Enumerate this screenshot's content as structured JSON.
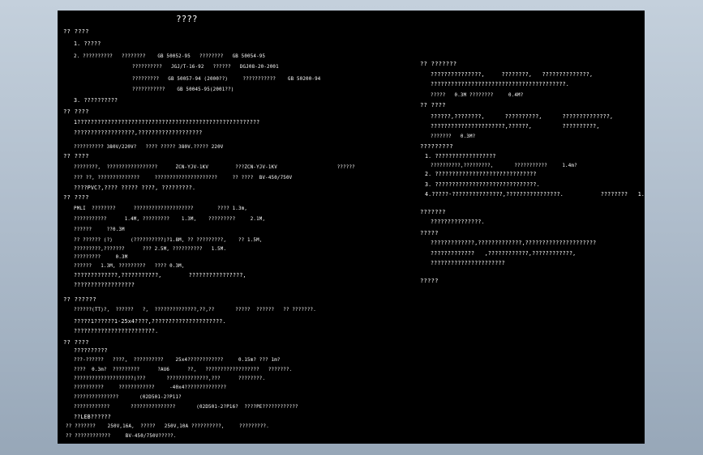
{
  "drawing": {
    "title": "????",
    "left_lines": [
      "?? ????",
      "1. ?????",
      "2. ??????????   ????????    GB 50052-95   ????????   GB 50054-95",
      "??????????   JGJ/T-16-92   ??????   DGJ08-20-2001",
      "?????????   GB 50057-94 (2000??)     ???????????    GB 50200-94",
      "???????????    GB 50045-95(2001??)",
      "3. ??????????",
      "?? ????",
      "1??????????????????????????????????????????????????????",
      "??????????????????,???????????????????",
      "?????????? 380V/220V?   ???? ????? 380V.????? 220V",
      "?? ????",
      "????????,  ?????????????????      ZCN-YJV-1KV         ???ZCN-YJV-1KV                    ??????",
      "??? ??, ??????????????     ?????????????????????     ?? ????  BV-450/750V",
      "????PVC?,???? ????? ????, ?????????.",
      "?? ????",
      "PMLI  ????????      ????????????????????        ???? 1.3m,",
      "???????????      1.4M, ?????????    1.3M,    ?????????     2.1M,",
      "??????     ??0.3M",
      "?? ?????? (?)      (??????????)?1.8M, ?? ?????????,    ?? 1.5M,",
      "?????????,???????      ??? 2.5M, ??????????   1.5M.",
      "?????????     0.3M",
      "??????   1.3M, ?????????   ???? 0.3M,",
      "?????????????,???????????,        ????????????????,",
      "??????????????????",
      "?? ??????",
      "??????(TT)?,  ??????   ?,  ??????????????,??,??       ?????  ??????   ?? ???????.",
      "?????1??????1-25x4????,?????????????????????.",
      "????????????????????????.",
      "?? ????",
      "??????????",
      "???-??????   ????,  ??????????    25x4????????????     0.15m? ??? 1m?",
      "????  0.3m?  ?????????      ?AU6      ??,   ??????????????????   ???????.",
      "????????????????????(???       ??????????????,???      ????????.",
      "??????????     ????????????     -40x4??????????????",
      "???????????????       (02D501-2?P11?",
      "????????????       ???????????????       (02D501-2?P16?  ????PE????????????",
      "??LEB??????",
      "?? ???????    250V,16A,  ?????   250V,10A ??????????,     ?????????.",
      "?? ????????????     BV-450/750V?????."
    ],
    "right_lines": [
      "?? ???????",
      "???????????????,     ????????,   ??????????????,",
      "????????????????????????????????????????.",
      "?????   0.3M ????????     0.4M?",
      "?? ????",
      "??????,????????,      ??????????,      ??????????????,",
      "??????????????????????,??????,         ??????????,",
      "???????   0.3M?",
      "?????????",
      "1. ??????????????????",
      "??????????,?????????,       ???????????     1.4m?",
      "2. ??????????????????????????????",
      "3. ??????????????????????????????.",
      "4.?????-???????????????,????????????????.           ????????   1.3m?",
      "???????",
      "???????????????.",
      "?????",
      "?????????????,?????????????,?????????????????????",
      "?????????????   ,????????????,????????????,",
      "??????????????????????",
      "?????"
    ]
  }
}
